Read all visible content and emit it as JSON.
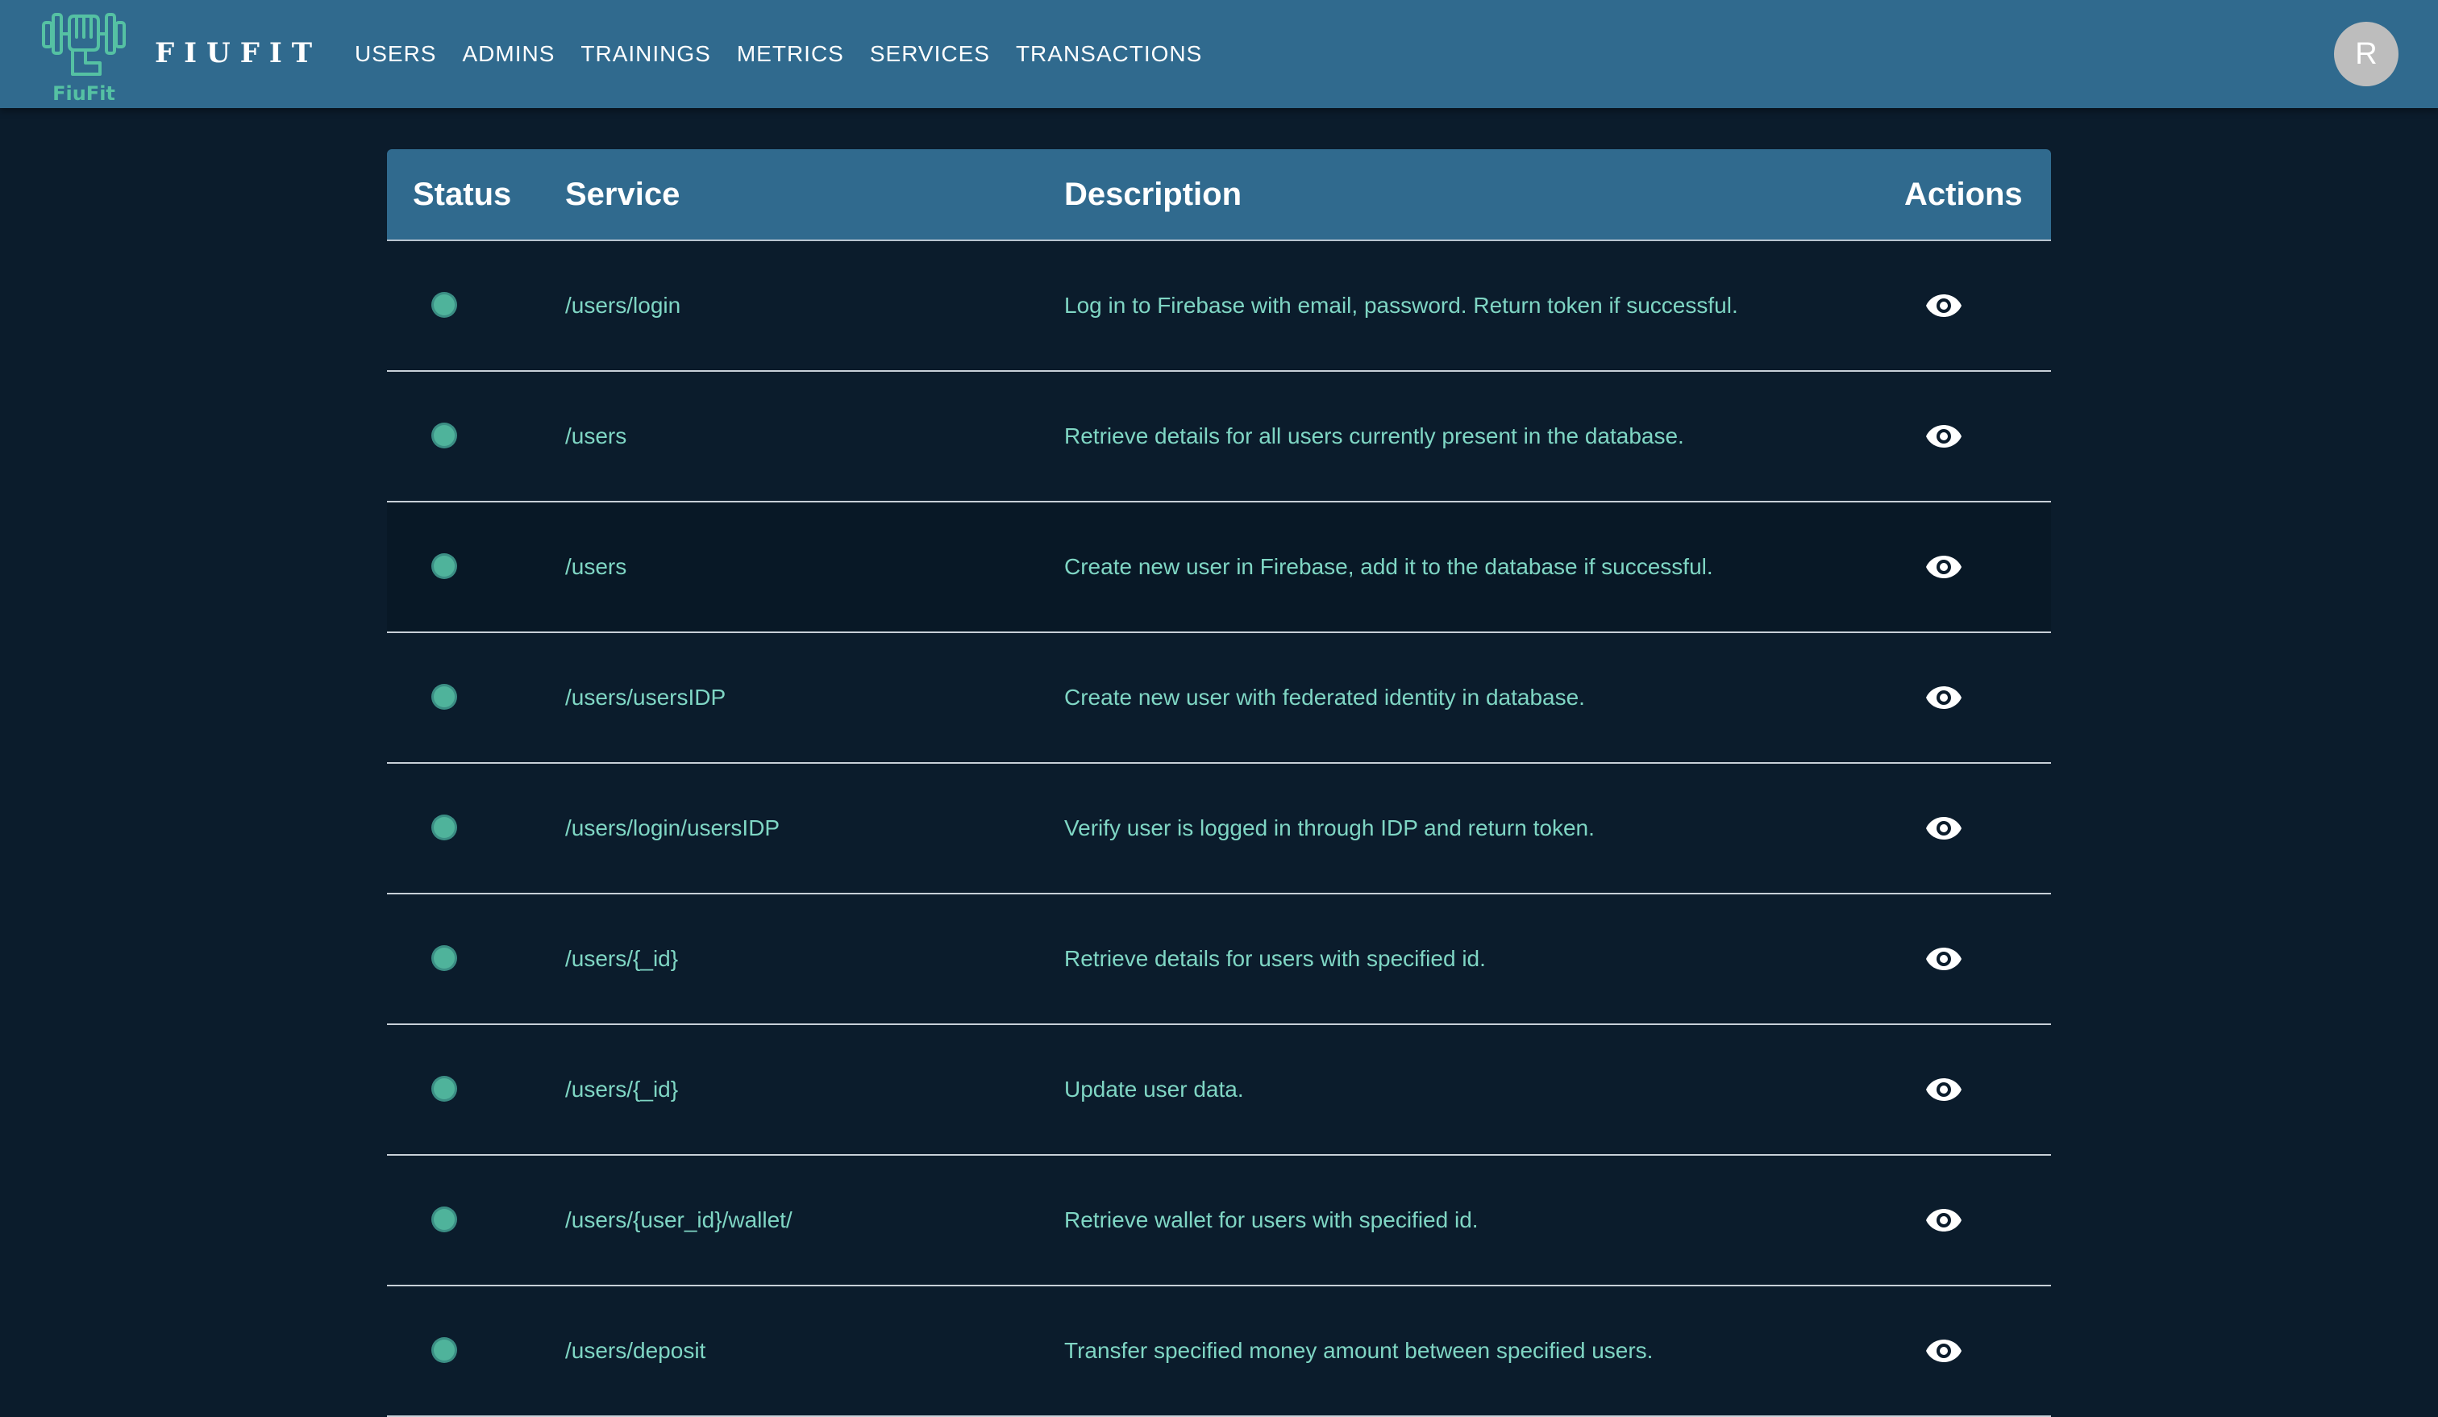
{
  "app": {
    "logo_caption": "FiuFit",
    "brand": "FIUFIT",
    "avatar_initial": "R"
  },
  "nav": [
    {
      "label": "USERS"
    },
    {
      "label": "ADMINS"
    },
    {
      "label": "TRAININGS"
    },
    {
      "label": "METRICS"
    },
    {
      "label": "SERVICES"
    },
    {
      "label": "TRANSACTIONS"
    }
  ],
  "table": {
    "headers": {
      "status": "Status",
      "service": "Service",
      "description": "Description",
      "actions": "Actions"
    },
    "rows": [
      {
        "service": "/users/login",
        "description": "Log in to Firebase with email, password. Return token if successful."
      },
      {
        "service": "/users",
        "description": "Retrieve details for all users currently present in the database."
      },
      {
        "service": "/users",
        "description": "Create new user in Firebase, add it to the database if successful."
      },
      {
        "service": "/users/usersIDP",
        "description": "Create new user with federated identity in database."
      },
      {
        "service": "/users/login/usersIDP",
        "description": "Verify user is logged in through IDP and return token."
      },
      {
        "service": "/users/{_id}",
        "description": "Retrieve details for users with specified id."
      },
      {
        "service": "/users/{_id}",
        "description": "Update user data."
      },
      {
        "service": "/users/{user_id}/wallet/",
        "description": "Retrieve wallet for users with specified id."
      },
      {
        "service": "/users/deposit",
        "description": "Transfer specified money amount between specified users."
      }
    ]
  },
  "colors": {
    "appbar": "#306a8e",
    "background": "#0b1c2c",
    "accent": "#4fb39b",
    "text": "#7fd6c4"
  },
  "icons": {
    "logo": "dumbbell-fist-icon",
    "status": "status-dot-icon",
    "action": "eye-icon"
  }
}
